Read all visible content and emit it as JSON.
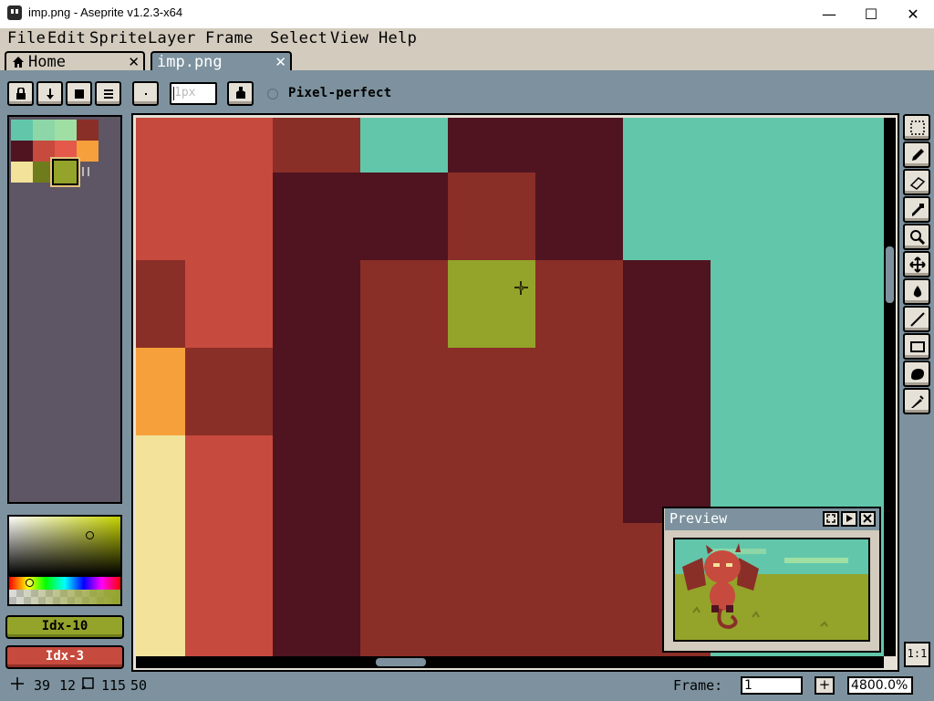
{
  "window": {
    "title": "imp.png - Aseprite v1.2.3-x64",
    "minimize": "—",
    "maximize": "☐",
    "close": "✕"
  },
  "menu": [
    "File",
    "Edit",
    "Sprite",
    "Layer",
    "Frame",
    "Select",
    "View",
    "Help"
  ],
  "tabs": [
    {
      "label": "Home",
      "close": "✕",
      "icon": "home-icon"
    },
    {
      "label": "imp.png",
      "close": "✕"
    }
  ],
  "context_bar": {
    "brush_size_placeholder": "1px",
    "pixel_perfect_label": "Pixel-perfect",
    "buttons": [
      "lock-icon",
      "arrow-down-icon",
      "square-icon",
      "menu-icon"
    ]
  },
  "palette": {
    "swatches": [
      "#62c7aa",
      "#8cd6a8",
      "#a0dfa4",
      "#8a2e28",
      "#4f1420",
      "#c64a3d",
      "#e4594a",
      "#f6a03b",
      "#f2e29a",
      "#6f7c1c",
      "#94a32a"
    ],
    "selected_index": 10
  },
  "colors": {
    "fg_label": "Idx-10",
    "bg_label": "Idx-3",
    "fg_hex": "#94a32a",
    "bg_hex": "#c64a3d"
  },
  "preview": {
    "title": "Preview"
  },
  "tools": [
    "marquee-icon",
    "pencil-icon",
    "eraser-icon",
    "eyedropper-icon",
    "zoom-icon",
    "move-icon",
    "fill-icon",
    "line-icon",
    "rectangle-icon",
    "contour-icon",
    "blur-icon"
  ],
  "zoom_11": "1:1",
  "status": {
    "cursor_x": "39",
    "cursor_y": "12",
    "selection_w": "115",
    "selection_h": "50",
    "frame_label": "Frame:",
    "frame_value": "1",
    "frame_add": "+",
    "zoom_value": "4800.0%"
  }
}
